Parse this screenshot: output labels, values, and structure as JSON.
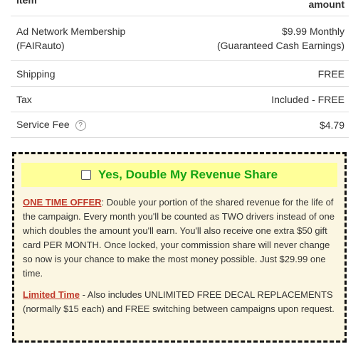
{
  "table": {
    "header": {
      "item": "Item",
      "amount": "amount"
    },
    "rows": [
      {
        "item_line1": "Ad Network Membership",
        "item_line2": "(FAIRauto)",
        "amount_line1": "$9.99 Monthly",
        "amount_line2": "(Guaranteed Cash Earnings)"
      },
      {
        "item": "Shipping",
        "amount": "FREE"
      },
      {
        "item": "Tax",
        "amount": "Included - FREE"
      },
      {
        "item": "Service Fee",
        "help_glyph": "?",
        "amount": "$4.79"
      }
    ]
  },
  "upsell": {
    "checkbox_checked": false,
    "title": "Yes, Double My Revenue Share",
    "offer_label": "ONE TIME OFFER",
    "offer_text": ": Double your portion of the shared revenue for the life of the campaign. Every month you'll be counted as TWO drivers instead of one which doubles the amount you'll earn. You'll also receive one extra $50 gift card PER MONTH. Once locked, your commission share will never change so now is your chance to make the most money possible. Just $29.99 one time.",
    "limited_label": "Limited Time",
    "limited_text": " - Also includes UNLIMITED FREE DECAL REPLACEMENTS (normally $15 each) and FREE switching between campaigns upon request.",
    "colors": {
      "title": "#14a314",
      "highlight": "#ffff99",
      "background": "#fbf6e2",
      "offer_label": "#c0392b"
    }
  }
}
